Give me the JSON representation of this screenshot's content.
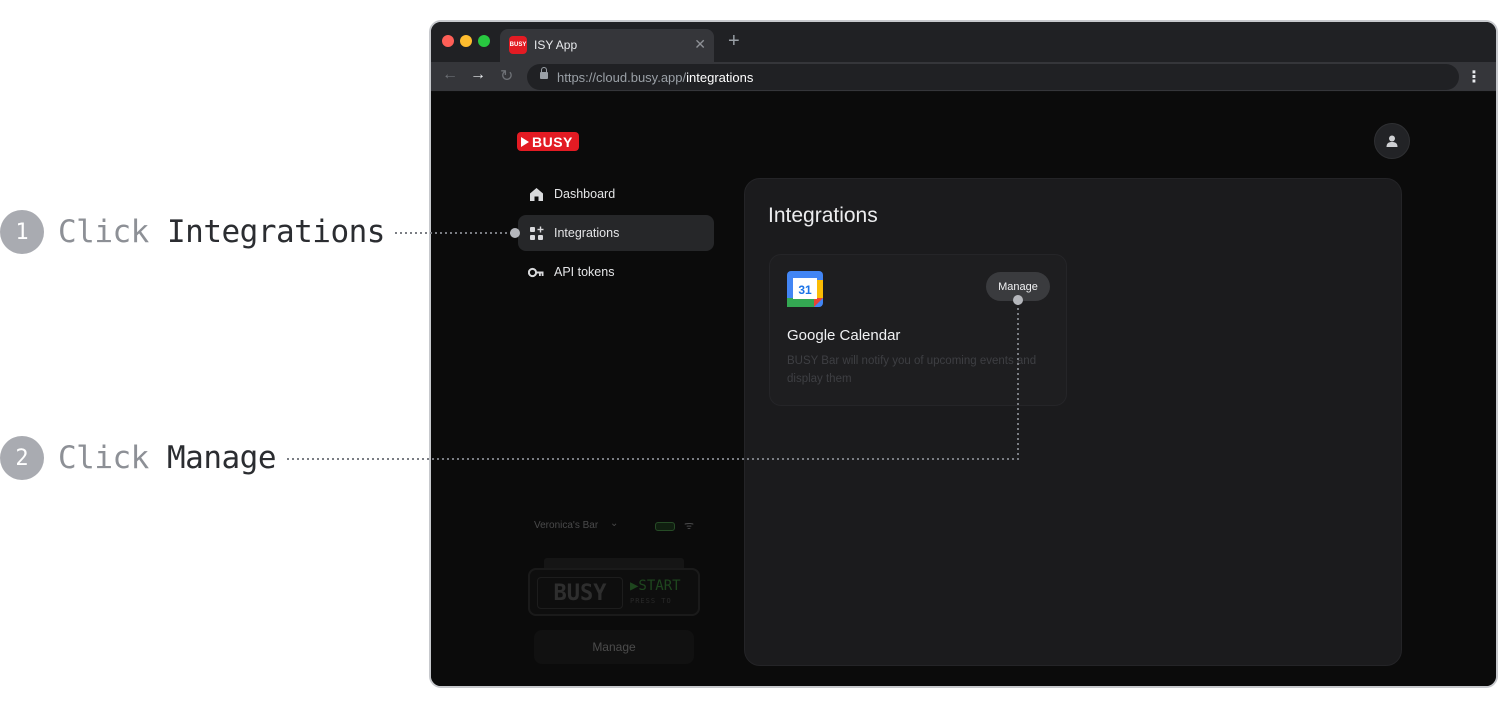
{
  "annotations": [
    {
      "number": "1",
      "verb": "Click",
      "target": "Integrations"
    },
    {
      "number": "2",
      "verb": "Click",
      "target": "Manage"
    }
  ],
  "browser": {
    "tab_title": "ISY App",
    "favicon_text": "BUSY",
    "url_base": "https://cloud.busy.app/",
    "url_path": "integrations"
  },
  "app": {
    "logo_text": "BUSY",
    "brand_color": "#e31b23",
    "sidebar": {
      "items": [
        {
          "label": "Dashboard",
          "icon": "home-icon"
        },
        {
          "label": "Integrations",
          "icon": "grid-plus-icon",
          "active": true
        },
        {
          "label": "API tokens",
          "icon": "key-icon"
        }
      ]
    },
    "device": {
      "name": "Veronica's Bar",
      "screen_left": "BUSY",
      "screen_right": "▶START",
      "screen_sub": "PRESS TO",
      "manage_label": "Manage"
    },
    "main": {
      "title": "Integrations",
      "cards": [
        {
          "icon": "google-calendar-icon",
          "icon_text": "31",
          "title": "Google Calendar",
          "description": "BUSY Bar will notify you of upcoming events and display them",
          "manage_label": "Manage"
        }
      ]
    }
  }
}
